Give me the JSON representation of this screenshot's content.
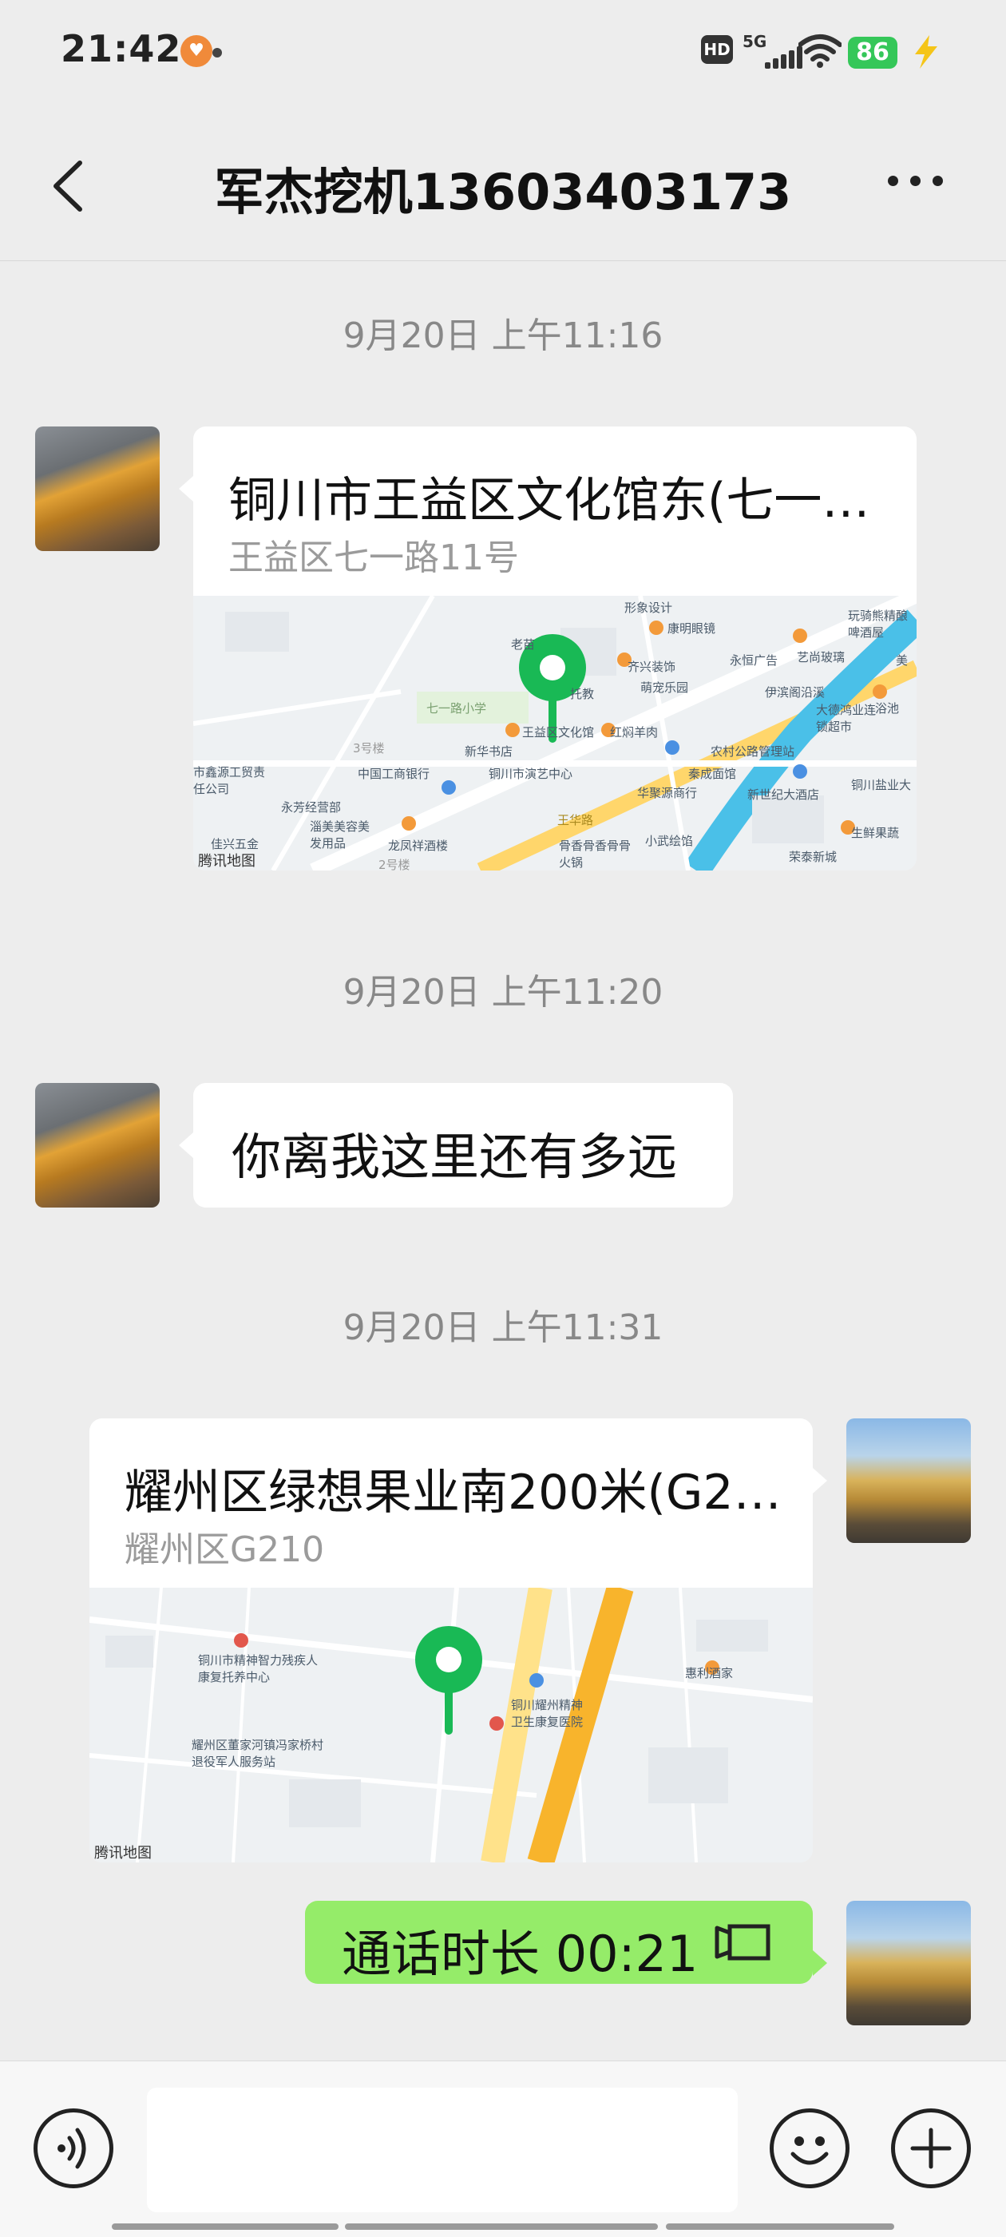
{
  "status_bar": {
    "time": "21:42",
    "network": "5G",
    "hd": "HD",
    "battery": "86",
    "colors": {
      "battery": "#35c759",
      "charging": "#f5c518"
    }
  },
  "header": {
    "title": "军杰挖机13603403173",
    "back_icon": "chevron-left-icon",
    "more_icon": "more-dots-icon"
  },
  "messages": [
    {
      "timestamp": "9月20日 上午11:16",
      "type": "location",
      "sender": "contact",
      "title": "铜川市王益区文化馆东(七一…",
      "address": "王益区七一路11号",
      "map_labels": [
        "形象设计",
        "康明眼镜",
        "玩骑熊精酿啤酒屋",
        "老苗",
        "齐兴装饰",
        "永恒广告",
        "艺尚玻璃",
        "萌宠乐园",
        "托教",
        "伊滨阁沿溪",
        "美",
        "七一路小学",
        "王益区文化馆",
        "红焖羊肉",
        "大德鸿业连锁超市",
        "浴池",
        "3号楼",
        "新华书店",
        "农村公路管理站",
        "市鑫源工贸责任公司",
        "中国工商银行",
        "铜川市演艺中心",
        "秦成面馆",
        "铜川盐业大",
        "永芳经营部",
        "华聚源商行",
        "新世纪大酒店",
        "淄美美容美发用品",
        "龙凤祥酒楼",
        "王华路",
        "小武绘馅",
        "生鲜果蔬",
        "佳兴五金",
        "骨香骨香骨骨火锅",
        "荣泰新城",
        "2号楼"
      ],
      "watermark": "腾讯地图"
    },
    {
      "timestamp": "9月20日 上午11:20",
      "type": "text",
      "sender": "contact",
      "text": "你离我这里还有多远"
    },
    {
      "timestamp": "9月20日 上午11:31",
      "type": "location",
      "sender": "me",
      "title": "耀州区绿想果业南200米(G2…",
      "address": "耀州区G210",
      "map_labels": [
        "铜川市精神智力残疾人康复托养中心",
        "铜川耀州精神卫生康复医院",
        "惠利酒家",
        "耀州区董家河镇冯家桥村退役军人服务站"
      ],
      "watermark": "腾讯地图"
    },
    {
      "type": "call",
      "sender": "me",
      "text": "通话时长 00:21",
      "icon": "video-call-icon"
    }
  ],
  "input_bar": {
    "voice_icon": "voice-icon",
    "emoji_icon": "emoji-icon",
    "plus_icon": "plus-icon",
    "input_value": ""
  },
  "colors": {
    "background": "#ededed",
    "bubble_me": "#95ec69",
    "bubble_contact": "#ffffff",
    "map_pin": "#19b955",
    "timestamp_text": "#888888"
  }
}
